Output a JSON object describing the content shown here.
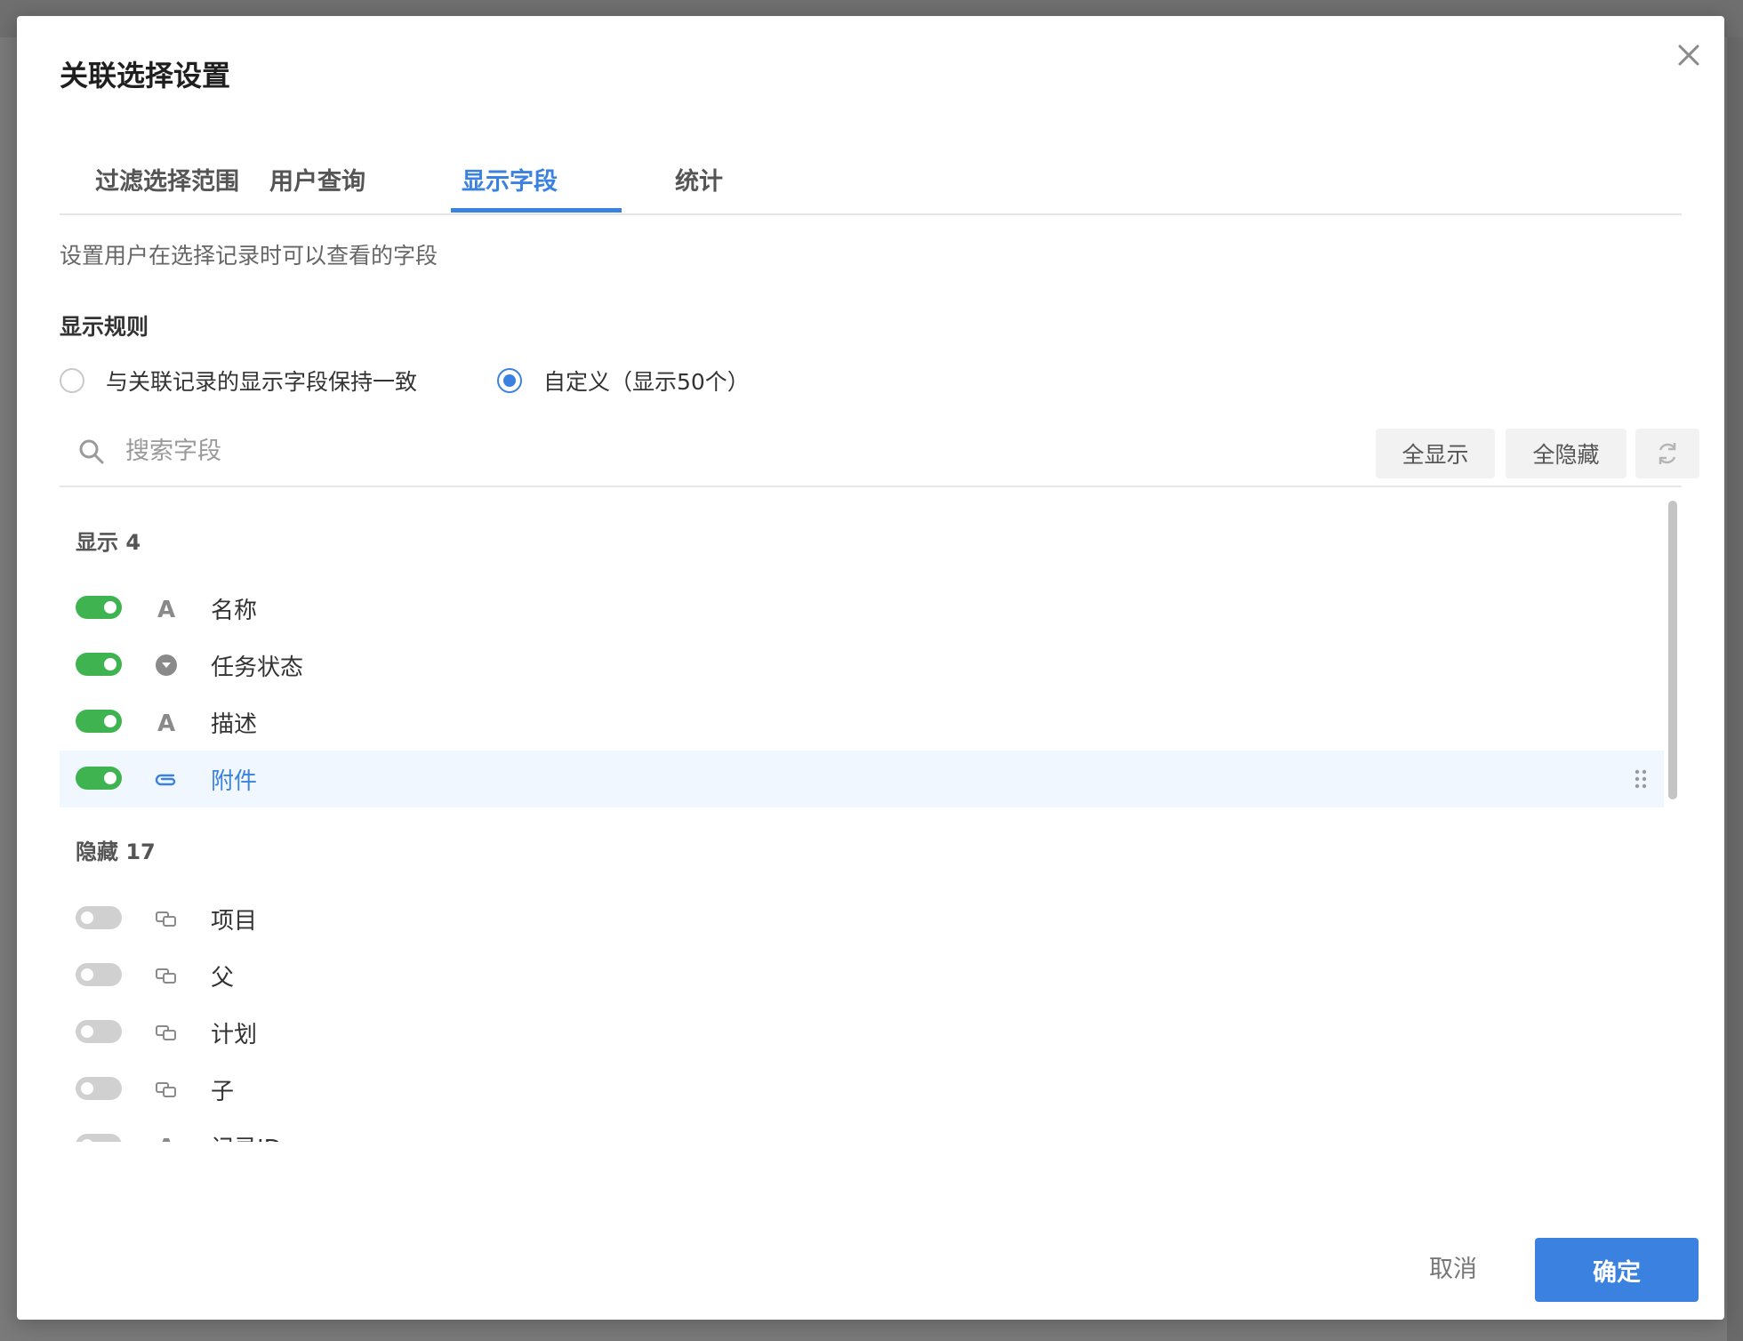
{
  "colors": {
    "accent": "#3b82e0",
    "toggle_on": "#3fb34f",
    "toggle_off": "#d0d0d0",
    "highlight_row": "#f1f7ff"
  },
  "modal": {
    "title": "关联选择设置",
    "tabs": [
      {
        "label": "过滤选择范围",
        "active": false
      },
      {
        "label": "用户查询",
        "active": false
      },
      {
        "label": "显示字段",
        "active": true
      },
      {
        "label": "统计",
        "active": false
      }
    ],
    "description": "设置用户在选择记录时可以查看的字段",
    "display_rule": {
      "label": "显示规则",
      "options": [
        {
          "label": "与关联记录的显示字段保持一致",
          "checked": false
        },
        {
          "label": "自定义（显示50个）",
          "checked": true
        }
      ]
    },
    "search": {
      "placeholder": "搜索字段",
      "value": ""
    },
    "actions": {
      "show_all": "全显示",
      "hide_all": "全隐藏",
      "reset_icon": "refresh-icon"
    },
    "shown_group": {
      "title": "显示 4",
      "fields": [
        {
          "name": "名称",
          "icon": "text-type-icon",
          "enabled": true
        },
        {
          "name": "任务状态",
          "icon": "select-type-icon",
          "enabled": true
        },
        {
          "name": "描述",
          "icon": "text-type-icon",
          "enabled": true
        },
        {
          "name": "附件",
          "icon": "attachment-icon",
          "enabled": true,
          "highlighted": true
        }
      ]
    },
    "hidden_group": {
      "title": "隐藏 17",
      "fields": [
        {
          "name": "项目",
          "icon": "relation-icon",
          "enabled": false
        },
        {
          "name": "父",
          "icon": "relation-icon",
          "enabled": false
        },
        {
          "name": "计划",
          "icon": "relation-icon",
          "enabled": false
        },
        {
          "name": "子",
          "icon": "relation-icon",
          "enabled": false
        },
        {
          "name": "记录ID",
          "icon": "text-type-icon",
          "enabled": false
        }
      ]
    },
    "footer": {
      "cancel": "取消",
      "confirm": "确定"
    }
  }
}
